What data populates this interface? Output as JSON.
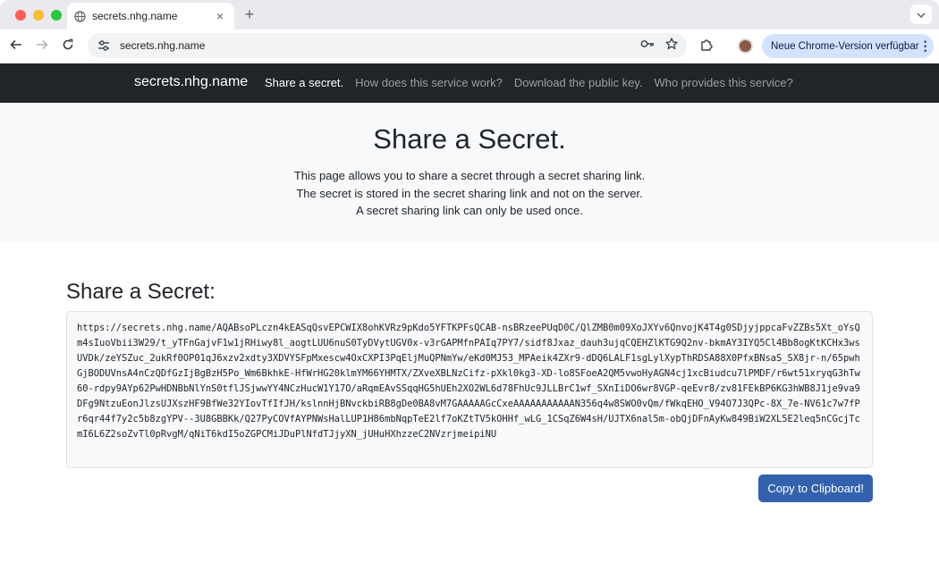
{
  "browser": {
    "tab_title": "secrets.nhg.name",
    "url": "secrets.nhg.name",
    "update_label": "Neue Chrome-Version verfügbar",
    "new_tab_symbol": "+",
    "close_symbol": "×",
    "menu_symbol": "⋮"
  },
  "navbar": {
    "brand": "secrets.nhg.name",
    "links": [
      {
        "label": "Share a secret.",
        "active": true
      },
      {
        "label": "How does this service work?",
        "active": false
      },
      {
        "label": "Download the public key.",
        "active": false
      },
      {
        "label": "Who provides this service?",
        "active": false
      }
    ]
  },
  "hero": {
    "title": "Share a Secret.",
    "lines": [
      "This page allows you to share a secret through a secret sharing link.",
      "The secret is stored in the secret sharing link and not on the server.",
      "A secret sharing link can only be used once."
    ]
  },
  "main": {
    "title": "Share a Secret:",
    "secret_link": "https://secrets.nhg.name/AQABsoPLczn4kEASqQsvEPCWIX8ohKVRz9pKdo5YFTKPFsQCAB-nsBRzeePUqD0C/QlZMB0m09XoJXYv6QnvojK4T4g0SDjyjppcaFvZZBs5Xt_oYsQm4sIuoVbii3W29/t_yTFnGajvF1w1jRHiwy8l_aogtLUU6nuS0TyDVytUGV0x-v3rGAPMfnPAIq7PY7/sidf8Jxaz_dauh3ujqCQEHZlKTG9Q2nv-bkmAY3IYQ5Cl4Bb8ogKtKCHx3wsUVDk/zeYSZuc_2ukRf0OP01qJ6xzv2xdty3XDVYSFpMxescw4OxCXPI3PqEljMuQPNmYw/eKd0MJ53_MPAeik4ZXr9-dDQ6LALF1sgLylXypThRDSA88X0PfxBNsaS_SX8jr-n/65pwhGjBODUVnsA4nCzQDfGzIjBgBzH5Po_Wm6BkhkE-HfWrHG20klmYM66YHMTX/ZXveXBLNzCifz-pXkl0kg3-XD-lo8SFoeA2QM5vwoHyAGN4cj1xcBiudcu7lPMDF/r6wt51xryqG3hTw60-rdpy9AYp62PwHDNBbNlYnS0tflJSjwwYY4NCzHucW1Y17O/aRqmEAvSSqqHG5hUEh2XO2WL6d78FhUc9JLLBrC1wf_SXnIiDO6wr8VGP-qeEvr8/zv81FEkBP6KG3hWB8J1je9va9DFg9NtzuEonJlzsUJXszHF9BfWe32YIovTfIfJH/kslnnHjBNvckbiRB8gDe0BA8vM7GAAAAAGcCxeAAAAAAAAAAAN356q4w8SWO0vQm/fWkqEHO_V94O7J3QPc-8X_7e-NV61c7w7fPr6qr44f7y2c5b8zgYPV--3U8GBBKk/Q27PyCOVfAYPNWsHalLUP1H86mbNqpTeE2lf7oKZtTV5kOHHf_wLG_1CSqZ6W4sH/UJTX6nal5m-obQjDFnAyKw849BiW2XL5E2leq5nCGcjTcmI6L6Z2soZvTl0pRvgM/qNiT6kdI5oZGPCMiJDuPlNfdTJjyXN_jUHuHXhzzeC2NVzrjmeipiNU",
    "copy_label": "Copy to Clipboard!"
  },
  "colors": {
    "navbar_bg": "#212529",
    "hero_bg": "#f8f9fa",
    "button_bg": "#3461ad",
    "update_pill_bg": "#d3e3fd"
  }
}
